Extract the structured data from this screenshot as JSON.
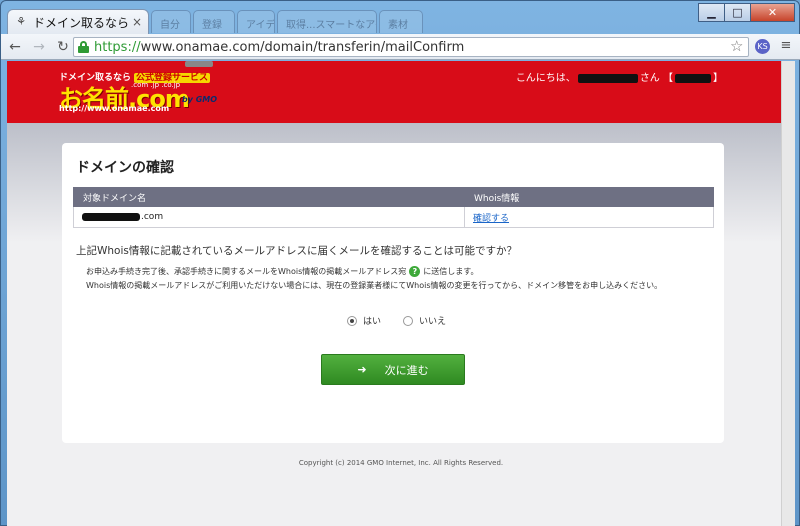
{
  "browser": {
    "tab_title": "ドメイン取るなら お",
    "ghost_tabs": [
      "自分",
      "登録",
      "アイデア",
      "取得...スマートなアイデア",
      "素材"
    ],
    "url_scheme": "https://",
    "url_rest": "www.onamae.com/domain/transferin/mailConfirm",
    "ext_label": "KS"
  },
  "header": {
    "logo_tagline": "ドメイン取るなら",
    "logo_badge": "公式登録サービス",
    "logo_tlds": ".com .jp .co.jp",
    "logo_name": "お名前.com",
    "logo_url": "http://www.onamae.com",
    "logo_gmo": "by GMO",
    "greeting_prefix": "こんにちは、",
    "greeting_san": "さん",
    "greeting_close": "】"
  },
  "main": {
    "title": "ドメインの確認",
    "table": {
      "headers": [
        "対象ドメイン名",
        "Whois情報"
      ],
      "rows": [
        {
          "domain_suffix": ".com",
          "whois_link": "確認する"
        }
      ]
    },
    "question": "上記Whois情報に記載されているメールアドレスに届くメールを確認することは可能ですか？",
    "note1_before": "お申込み手続き完了後、承認手続きに関するメールをWhois情報の掲載メールアドレス宛",
    "note1_after": "に送信します。",
    "note2": "Whois情報の掲載メールアドレスがご利用いただけない場合には、現在の登録業者様にてWhois情報の変更を行ってから、ドメイン移管をお申し込みください。",
    "radio_yes": "はい",
    "radio_no": "いいえ",
    "next_button": "次に進む"
  },
  "footer": {
    "copyright": "Copyright (c) 2014 GMO Internet, Inc. All Rights Reserved."
  },
  "colors": {
    "header_red": "#d80c18",
    "button_green": "#3e9e30",
    "table_header": "#6e7083",
    "link_blue": "#1a65c8"
  }
}
